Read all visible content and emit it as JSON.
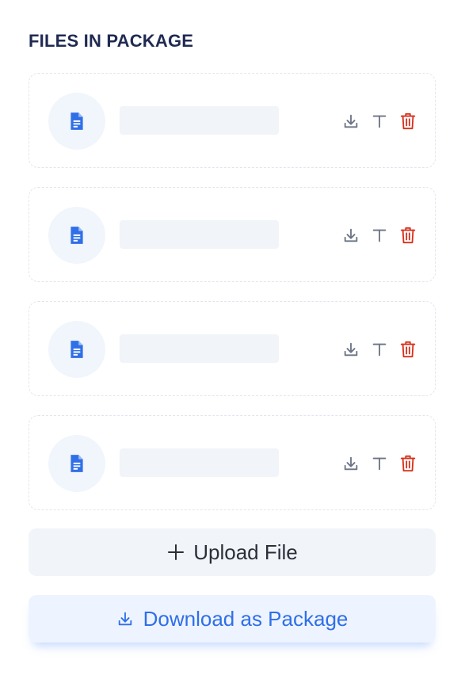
{
  "section": {
    "title": "FILES IN PACKAGE"
  },
  "files": [
    {
      "name": ""
    },
    {
      "name": ""
    },
    {
      "name": ""
    },
    {
      "name": ""
    }
  ],
  "icons": {
    "file": "document-icon",
    "download": "download-icon",
    "rename": "text-t-icon",
    "delete": "trash-icon",
    "upload": "plus-icon"
  },
  "actions": {
    "upload_label": "Upload File",
    "download_package_label": "Download as Package"
  },
  "colors": {
    "title": "#1f2a52",
    "file_icon": "#2f6fe8",
    "action_icon": "#6b7384",
    "delete_icon": "#d6311d",
    "primary": "#2f6fe8"
  }
}
